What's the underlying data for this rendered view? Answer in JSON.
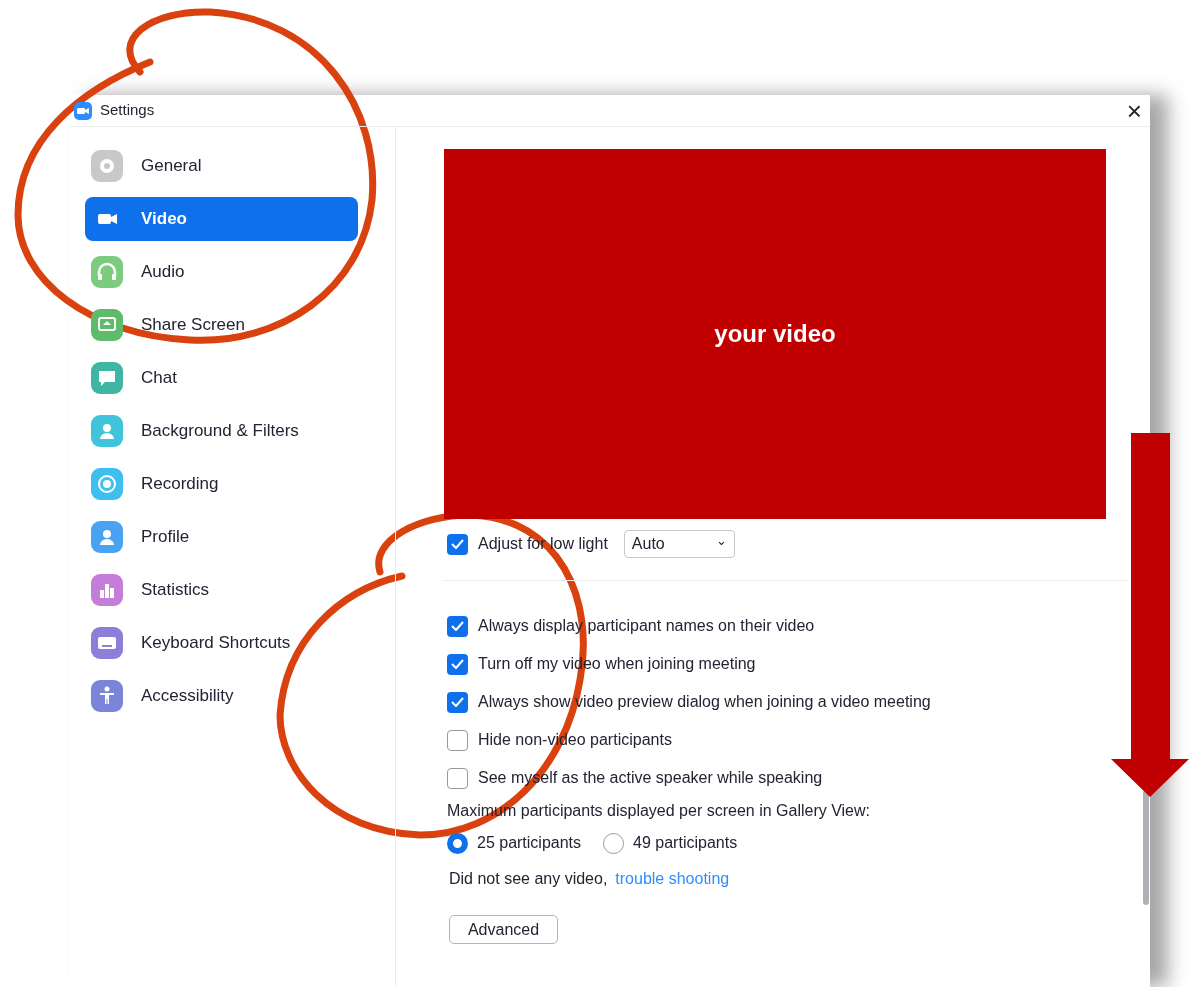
{
  "window": {
    "title": "Settings",
    "close": "×"
  },
  "sidebar": {
    "items": [
      {
        "label": "General",
        "kind": "gear",
        "color": "#c8c8c8",
        "selected": false
      },
      {
        "label": "Video",
        "kind": "camera",
        "selected": true
      },
      {
        "label": "Audio",
        "kind": "headphones",
        "color": "#7ccb7e",
        "selected": false
      },
      {
        "label": "Share Screen",
        "kind": "share",
        "color": "#5dbb6a",
        "selected": false
      },
      {
        "label": "Chat",
        "kind": "chat",
        "color": "#3fb6a4",
        "selected": false
      },
      {
        "label": "Background & Filters",
        "kind": "person",
        "color": "#3fc4d9",
        "selected": false
      },
      {
        "label": "Recording",
        "kind": "record",
        "color": "#3fbff0",
        "selected": false
      },
      {
        "label": "Profile",
        "kind": "person",
        "color": "#4aa3f2",
        "selected": false
      },
      {
        "label": "Statistics",
        "kind": "bars",
        "color": "#c47dd9",
        "selected": false
      },
      {
        "label": "Keyboard Shortcuts",
        "kind": "keyboard",
        "color": "#8c7fd9",
        "selected": false
      },
      {
        "label": "Accessibility",
        "kind": "accessibility",
        "color": "#7a85d9",
        "selected": false
      }
    ]
  },
  "video_preview": {
    "label": "your video"
  },
  "low_light": {
    "label": "Adjust for low light",
    "checked": true,
    "dropdown": "Auto",
    "caret": "⌄"
  },
  "options": [
    {
      "label": "Always display participant names on their video",
      "checked": true
    },
    {
      "label": "Turn off my video when joining meeting",
      "checked": true
    },
    {
      "label": "Always show video preview dialog when joining a video meeting",
      "checked": true
    },
    {
      "label": "Hide non-video participants",
      "checked": false
    },
    {
      "label": "See myself as the active speaker while speaking",
      "checked": false
    }
  ],
  "gallery": {
    "label": "Maximum participants displayed per screen in Gallery View:",
    "choices": [
      {
        "label": "25 participants",
        "selected": true
      },
      {
        "label": "49 participants",
        "selected": false
      }
    ]
  },
  "troubleshoot": {
    "text": "Did not see any video,",
    "link": "trouble shooting"
  },
  "advanced_button": "Advanced"
}
